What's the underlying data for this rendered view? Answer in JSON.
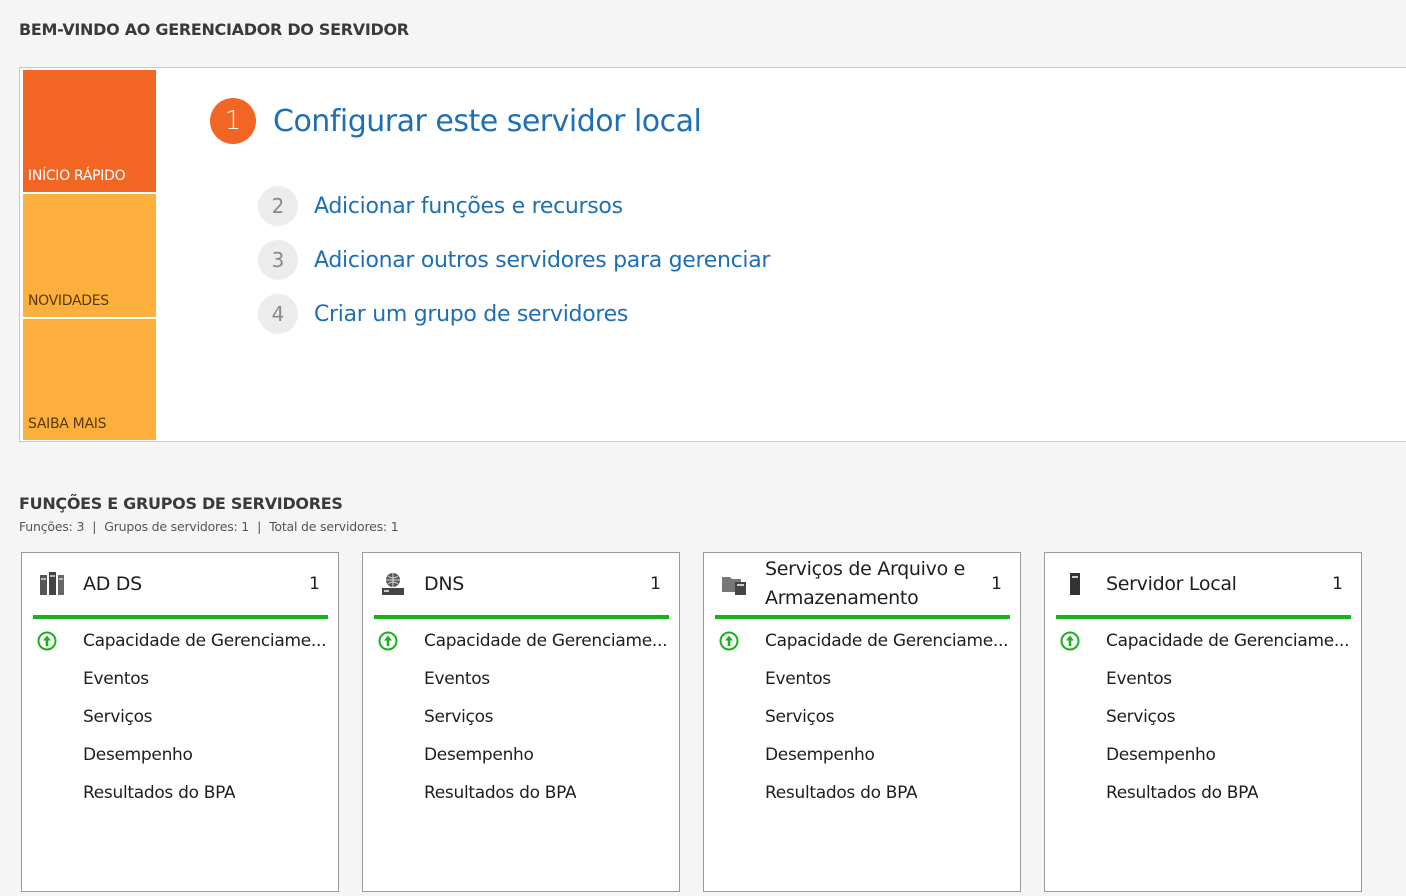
{
  "welcome": {
    "title": "BEM-VINDO AO GERENCIADOR DO SERVIDOR",
    "tiles": {
      "quick_start": "INÍCIO RÁPIDO",
      "whats_new": "NOVIDADES",
      "learn_more": "SAIBA MAIS"
    },
    "steps": [
      {
        "num": "1",
        "label": "Configurar este servidor local"
      },
      {
        "num": "2",
        "label": "Adicionar funções e recursos"
      },
      {
        "num": "3",
        "label": "Adicionar outros servidores para gerenciar"
      },
      {
        "num": "4",
        "label": "Criar um grupo de servidores"
      }
    ],
    "colors": {
      "accent": "#f26522",
      "tile_secondary": "#fcaf3c",
      "link": "#1f6fb5",
      "status_ok": "#17b31a"
    }
  },
  "roles": {
    "title": "FUNÇÕES E GRUPOS DE SERVIDORES",
    "summary": {
      "roles": "Funções: 3",
      "groups": "Grupos de servidores: 1",
      "total": "Total de servidores: 1",
      "sep": "|"
    },
    "cards": [
      {
        "icon": "ad-ds-icon",
        "title": "AD DS",
        "count": "1",
        "rows": [
          "Capacidade de Gerenciame...",
          "Eventos",
          "Serviços",
          "Desempenho",
          "Resultados do BPA"
        ]
      },
      {
        "icon": "dns-icon",
        "title": "DNS",
        "count": "1",
        "rows": [
          "Capacidade de Gerenciame...",
          "Eventos",
          "Serviços",
          "Desempenho",
          "Resultados do BPA"
        ]
      },
      {
        "icon": "file-storage-icon",
        "title": "Serviços de Arquivo e Armazenamento",
        "count": "1",
        "rows": [
          "Capacidade de Gerenciame...",
          "Eventos",
          "Serviços",
          "Desempenho",
          "Resultados do BPA"
        ]
      },
      {
        "icon": "local-server-icon",
        "title": "Servidor Local",
        "count": "1",
        "rows": [
          "Capacidade de Gerenciame...",
          "Eventos",
          "Serviços",
          "Desempenho",
          "Resultados do BPA"
        ]
      }
    ]
  }
}
